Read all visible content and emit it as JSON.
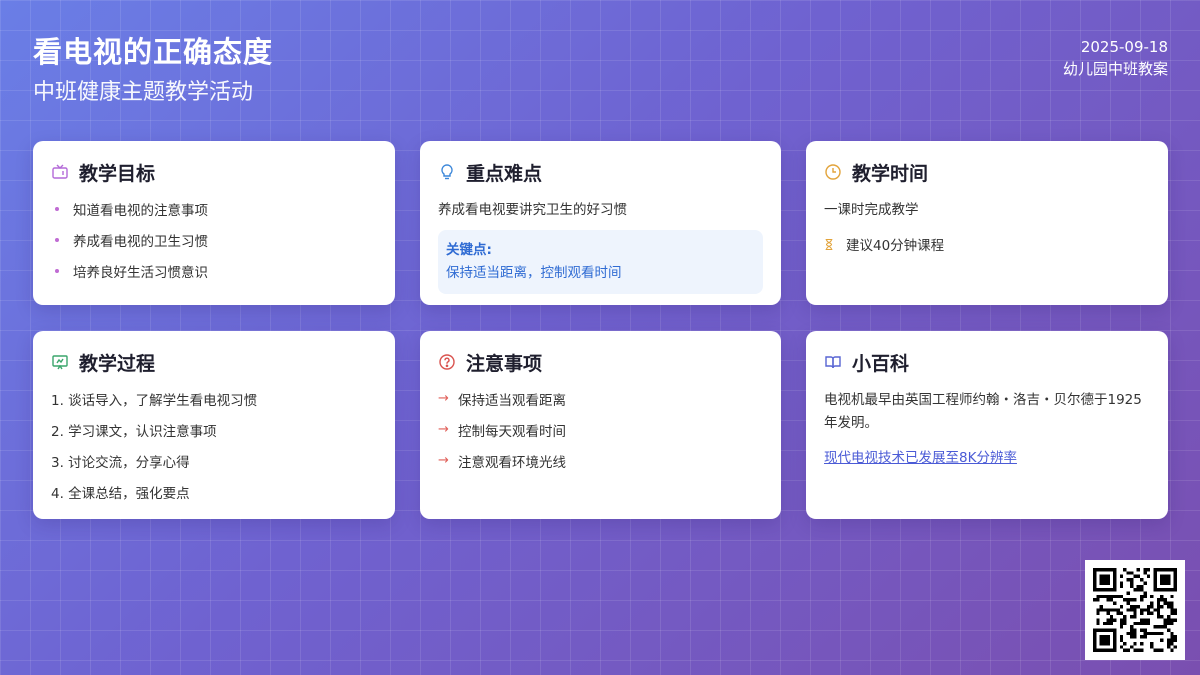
{
  "header": {
    "title": "看电视的正确态度",
    "subtitle": "中班健康主题教学活动",
    "date": "2025-09-18",
    "doc_type": "幼儿园中班教案"
  },
  "cards": {
    "goals": {
      "icon": "tv-icon",
      "icon_color": "#b46ad8",
      "title": "教学目标",
      "items": [
        "知道看电视的注意事项",
        "养成看电视的卫生习惯",
        "培养良好生活习惯意识"
      ]
    },
    "key_points": {
      "icon": "lightbulb-icon",
      "icon_color": "#3a86d9",
      "title": "重点难点",
      "text": "养成看电视要讲究卫生的好习惯",
      "key_label": "关键点:",
      "key_text": "保持适当距离，控制观看时间"
    },
    "time": {
      "icon": "clock-icon",
      "icon_color": "#e2a33a",
      "title": "教学时间",
      "text": "一课时完成教学",
      "suggestion": "建议40分钟课程"
    },
    "process": {
      "icon": "presentation-icon",
      "icon_color": "#3aa56b",
      "title": "教学过程",
      "steps": [
        "1. 谈话导入，了解学生看电视习惯",
        "2. 学习课文，认识注意事项",
        "3. 讨论交流，分享心得",
        "4. 全课总结，强化要点"
      ]
    },
    "notes": {
      "icon": "question-circle-icon",
      "icon_color": "#d9534f",
      "title": "注意事项",
      "items": [
        "保持适当观看距离",
        "控制每天观看时间",
        "注意观看环境光线"
      ]
    },
    "wiki": {
      "icon": "book-icon",
      "icon_color": "#5865d3",
      "title": "小百科",
      "text": "电视机最早由英国工程师约翰・洛吉・贝尔德于1925年发明。",
      "link_text": "现代电视技术已发展至8K分辨率"
    }
  }
}
